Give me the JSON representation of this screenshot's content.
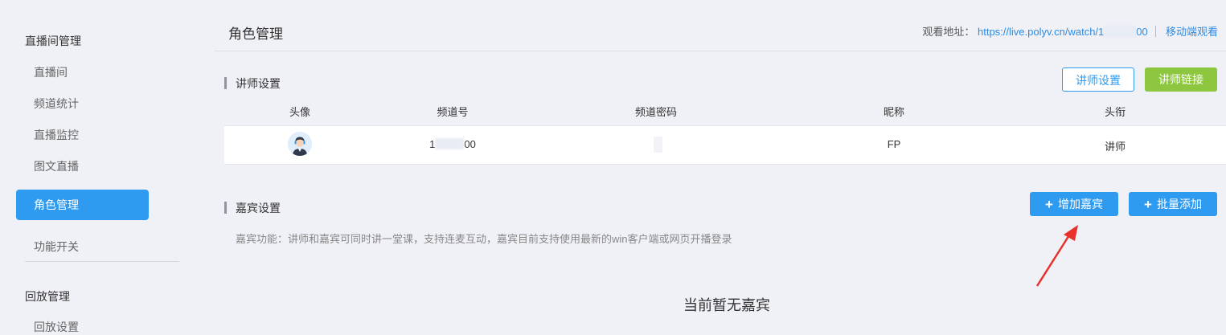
{
  "sidebar": {
    "group_live": "直播间管理",
    "items": [
      "直播间",
      "频道统计",
      "直播监控",
      "图文直播"
    ],
    "active_item": "角色管理",
    "feature_switch": "功能开关",
    "group_playback": "回放管理",
    "playback_item": "回放设置"
  },
  "header": {
    "title": "角色管理",
    "watch_label": "观看地址：",
    "watch_url_prefix": "https://live.polyv.cn/watch/1",
    "watch_url_suffix": "00",
    "mobile_watch": "移动端观看"
  },
  "lecturer": {
    "section_title": "讲师设置",
    "settings_button": "讲师设置",
    "link_button": "讲师链接",
    "columns": [
      "头像",
      "频道号",
      "频道密码",
      "昵称",
      "头衔"
    ],
    "row": {
      "channel_prefix": "1",
      "channel_suffix": "00",
      "nickname": "FP",
      "rank": "讲师"
    }
  },
  "guest": {
    "section_title": "嘉宾设置",
    "add_button": "增加嘉宾",
    "batch_button": "批量添加",
    "hint": "嘉宾功能：讲师和嘉宾可同时讲一堂课，支持连麦互动，嘉宾目前支持使用最新的win客户端或网页开播登录",
    "empty_text": "当前暂无嘉宾"
  },
  "colors": {
    "primary": "#2e9af0",
    "green": "#8dc63f",
    "arrow": "#e8312a",
    "background": "#f0f1f6"
  }
}
